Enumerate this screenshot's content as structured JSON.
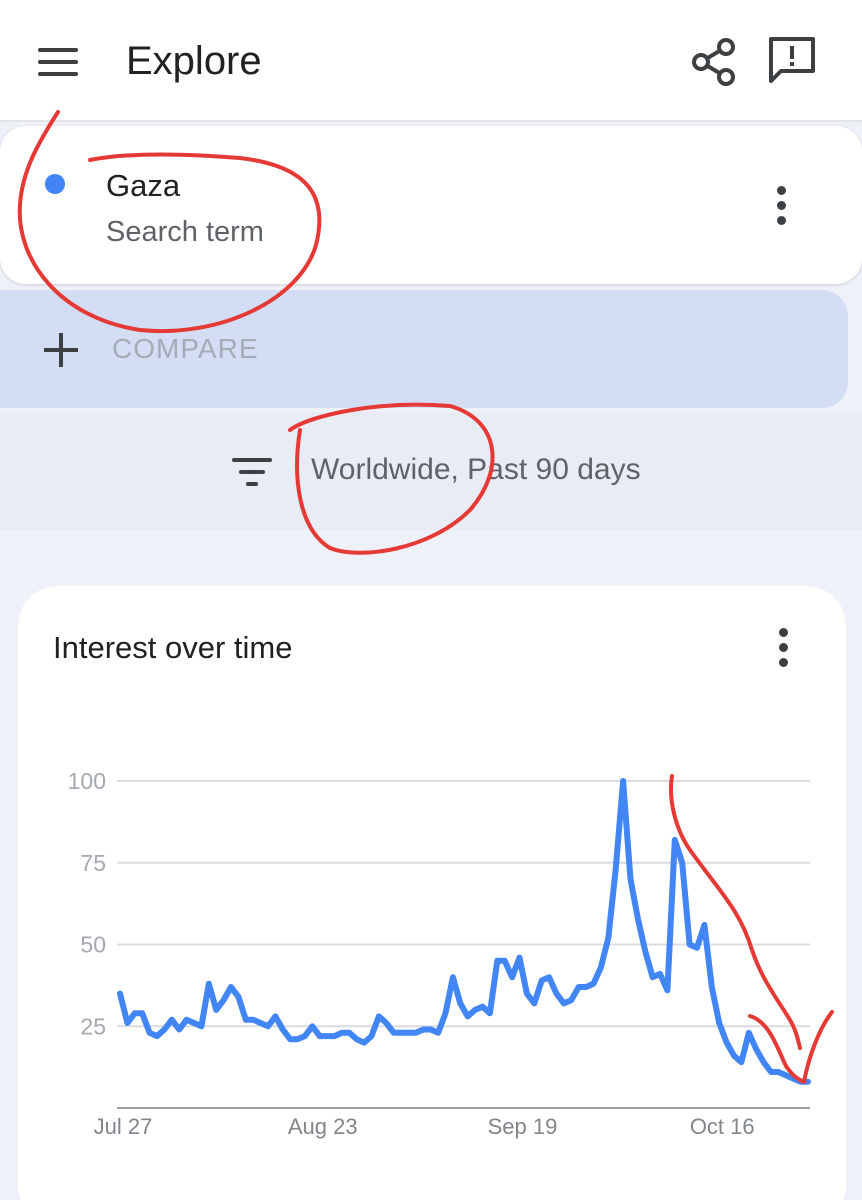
{
  "app_bar": {
    "title": "Explore",
    "icons": [
      "menu-icon",
      "share-icon",
      "feedback-icon"
    ]
  },
  "search_term": {
    "name": "Gaza",
    "type": "Search term",
    "color": "#4285f4"
  },
  "compare": {
    "label": "COMPARE"
  },
  "filter": {
    "label": "Worldwide, Past 90 days"
  },
  "chart_card": {
    "title": "Interest over time"
  },
  "annotation_color": "#e53935",
  "chart_data": {
    "type": "line",
    "title": "Interest over time",
    "xlabel": "",
    "ylabel": "",
    "ylim": [
      0,
      100
    ],
    "grid": true,
    "y_ticks": [
      "100",
      "75",
      "50",
      "25"
    ],
    "x_ticks": [
      {
        "label": "Jul 27",
        "index": 0
      },
      {
        "label": "Aug 23",
        "index": 27
      },
      {
        "label": "Sep 19",
        "index": 54
      },
      {
        "label": "Oct 16",
        "index": 81
      }
    ],
    "series": [
      {
        "color": "#4285f4",
        "values": [
          35,
          26,
          29,
          29,
          23,
          22,
          24,
          27,
          24,
          27,
          26,
          25,
          38,
          30,
          33,
          37,
          34,
          27,
          27,
          26,
          25,
          28,
          24,
          21,
          21,
          22,
          25,
          22,
          22,
          22,
          23,
          23,
          21,
          20,
          22,
          28,
          26,
          23,
          23,
          23,
          23,
          24,
          24,
          23,
          29,
          40,
          32,
          28,
          30,
          31,
          29,
          45,
          45,
          40,
          46,
          35,
          32,
          39,
          40,
          35,
          32,
          33,
          37,
          37,
          38,
          43,
          52,
          73,
          100,
          70,
          58,
          48,
          40,
          41,
          36,
          82,
          75,
          50,
          49,
          56,
          37,
          26,
          20,
          16,
          14,
          23,
          18,
          14,
          11,
          11,
          10,
          9,
          8,
          8
        ]
      }
    ]
  }
}
